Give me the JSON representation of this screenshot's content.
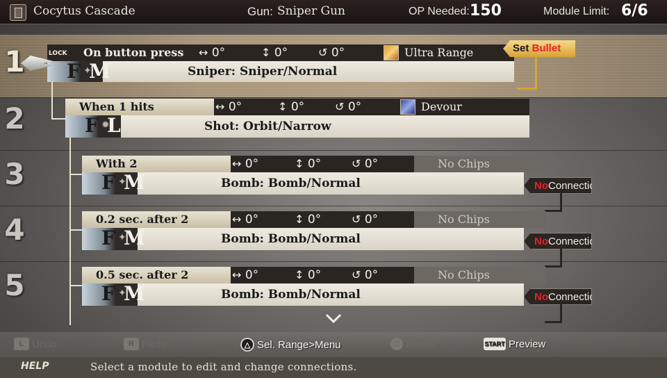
{
  "header": {
    "bullet_name": "Cocytus Cascade",
    "gun_label": "Gun:",
    "gun_name": "Sniper Gun",
    "op_label": "OP Needed:",
    "op_value": "150",
    "module_label": "Module  Limit:",
    "module_value": "6/6"
  },
  "slots": [
    "1",
    "2",
    "3",
    "4",
    "5"
  ],
  "modules": [
    {
      "lock_label": "LOCK",
      "trigger": "On button press",
      "h_angle": "0°",
      "v_angle": "0°",
      "rot_angle": "0°",
      "chip": "Ultra Range",
      "type_letter": "F",
      "size_letter": "M",
      "bullet": "Sniper: Sniper/Normal",
      "tag_prefix": "Set",
      "tag_suffix": "Bullet"
    },
    {
      "trigger": "When 1 hits",
      "h_angle": "0°",
      "v_angle": "0°",
      "rot_angle": "0°",
      "chip": "Devour",
      "type_letter": "F",
      "size_letter": "L",
      "bullet": "Shot: Orbit/Narrow"
    },
    {
      "trigger": "With 2",
      "h_angle": "0°",
      "v_angle": "0°",
      "rot_angle": "0°",
      "chip": "No Chips",
      "type_letter": "F",
      "size_letter": "M",
      "bullet": "Bomb: Bomb/Normal",
      "tag_prefix": "No",
      "tag_suffix": "Connection"
    },
    {
      "trigger": "0.2 sec. after 2",
      "h_angle": "0°",
      "v_angle": "0°",
      "rot_angle": "0°",
      "chip": "No Chips",
      "type_letter": "F",
      "size_letter": "M",
      "bullet": "Bomb: Bomb/Normal",
      "tag_prefix": "No",
      "tag_suffix": "Connection"
    },
    {
      "trigger": "0.5 sec. after 2",
      "h_angle": "0°",
      "v_angle": "0°",
      "rot_angle": "0°",
      "chip": "No Chips",
      "type_letter": "F",
      "size_letter": "M",
      "bullet": "Bomb: Bomb/Normal",
      "tag_prefix": "No",
      "tag_suffix": "Connection"
    }
  ],
  "controls": {
    "undo_button": "L",
    "undo": "Undo",
    "redo_button": "R",
    "redo": "Redo",
    "menu_button": "△",
    "menu": "Sel. Range>Menu",
    "delete_button": "□",
    "delete": "Delete",
    "preview_button": "START",
    "preview": "Preview"
  },
  "help": {
    "title": "HELP",
    "text": "Select a module to edit and change connections."
  },
  "icons": {
    "cursor": "sword-cursor-icon",
    "scroll": "chevron-down-icon",
    "chip_ultra_range": "ultra-range-chip-icon",
    "chip_devour": "devour-chip-icon"
  }
}
